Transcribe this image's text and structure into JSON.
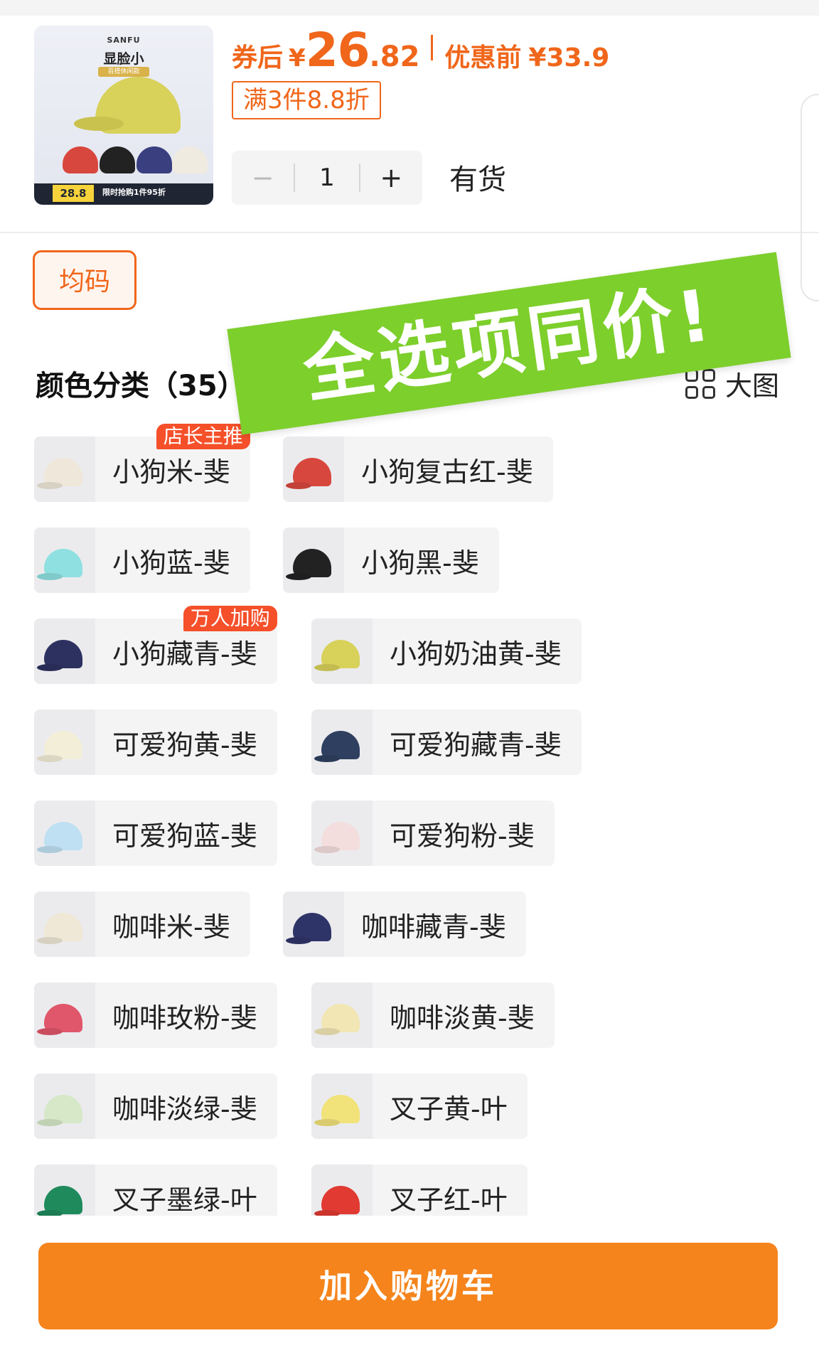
{
  "product": {
    "thumb_brand": "SANFU",
    "thumb_title": "显脸小",
    "thumb_tag": "百搭休闲款",
    "thumb_price": "28.8",
    "thumb_promo": "限时抢购1件95折"
  },
  "price": {
    "after_label": "券后",
    "yen": "¥",
    "after_int": "26",
    "after_dec": ".82",
    "before_label": "优惠前",
    "before_value": "¥33.9",
    "discount": "满3件8.8折"
  },
  "quantity": {
    "minus": "−",
    "value": "1",
    "plus": "+",
    "stock": "有货"
  },
  "size": {
    "selected": "均码"
  },
  "banner": {
    "text": "全选项同价!"
  },
  "colors": {
    "title": "颜色分类（35）",
    "view_label": "大图",
    "options": [
      {
        "label": "小狗米-斐",
        "badge": "店长主推",
        "color": "#efe8da"
      },
      {
        "label": "小狗复古红-斐",
        "color": "#d8473e"
      },
      {
        "label": "小狗蓝-斐",
        "color": "#8fe0e0"
      },
      {
        "label": "小狗黑-斐",
        "color": "#222222"
      },
      {
        "label": "小狗藏青-斐",
        "badge": "万人加购",
        "color": "#2d3160"
      },
      {
        "label": "小狗奶油黄-斐",
        "color": "#d8d15a"
      },
      {
        "label": "可爱狗黄-斐",
        "color": "#f3eed8"
      },
      {
        "label": "可爱狗藏青-斐",
        "color": "#2f3f60"
      },
      {
        "label": "可爱狗蓝-斐",
        "color": "#bfe0f2"
      },
      {
        "label": "可爱狗粉-斐",
        "color": "#f3dedd"
      },
      {
        "label": "咖啡米-斐",
        "color": "#efe8d6"
      },
      {
        "label": "咖啡藏青-斐",
        "color": "#2f3468"
      },
      {
        "label": "咖啡玫粉-斐",
        "color": "#e0566a"
      },
      {
        "label": "咖啡淡黄-斐",
        "color": "#f1e6b4"
      },
      {
        "label": "咖啡淡绿-斐",
        "color": "#d6e8c8"
      },
      {
        "label": "叉子黄-叶",
        "color": "#f1e27a"
      },
      {
        "label": "叉子墨绿-叶",
        "color": "#1f8a5c"
      },
      {
        "label": "叉子红-叶",
        "color": "#e03a32"
      }
    ]
  },
  "cart": {
    "button": "加入购物车"
  },
  "theme": {
    "accent": "#f0661a",
    "cart": "#f5841c",
    "banner": "#7dcf2c"
  }
}
